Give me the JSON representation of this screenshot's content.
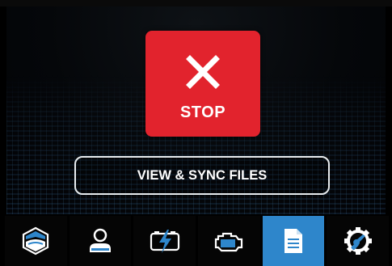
{
  "stop_button": {
    "label": "STOP",
    "icon": "x-icon",
    "color": "#e2232d"
  },
  "sync_button": {
    "label": "VIEW & SYNC FILES"
  },
  "navbar": {
    "active_index": 4,
    "active_color": "#2e86cb",
    "items": [
      {
        "name": "home",
        "icon": "boat-hull-icon"
      },
      {
        "name": "profile",
        "icon": "user-icon"
      },
      {
        "name": "power",
        "icon": "battery-bolt-icon"
      },
      {
        "name": "engine",
        "icon": "engine-icon"
      },
      {
        "name": "files",
        "icon": "document-icon"
      },
      {
        "name": "settings",
        "icon": "gear-wrench-icon"
      }
    ]
  }
}
